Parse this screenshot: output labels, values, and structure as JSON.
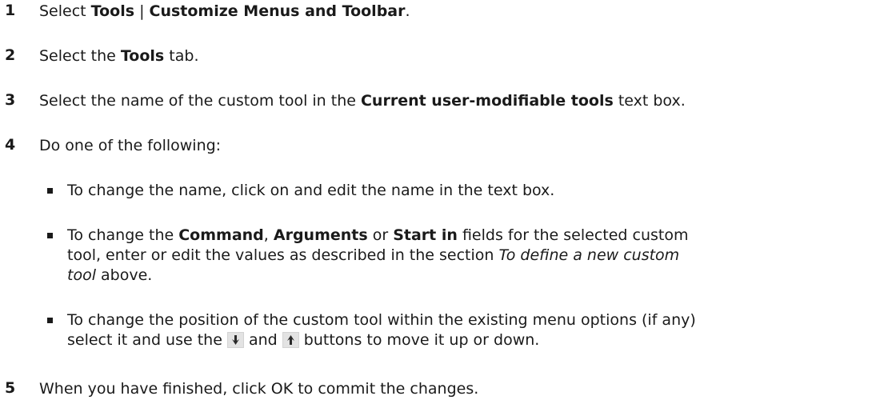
{
  "steps": [
    {
      "num": "1",
      "parts": [
        "Select ",
        "Tools",
        " | ",
        "Customize Menus and Toolbar",
        "."
      ]
    },
    {
      "num": "2",
      "parts": [
        "Select the ",
        "Tools",
        " tab."
      ]
    },
    {
      "num": "3",
      "parts": [
        "Select the name of the custom tool in the ",
        "Current user-modifiable tools",
        " text box."
      ]
    },
    {
      "num": "4",
      "text": "Do one of the following:"
    },
    {
      "num": "5",
      "text": "When you have finished, click OK to commit the changes."
    }
  ],
  "bullets": [
    {
      "text": "To change the name, click on and edit the name in the text box."
    },
    {
      "parts": [
        "To change the ",
        "Command",
        ", ",
        "Arguments",
        " or ",
        "Start in",
        " fields for the selected custom"
      ],
      "line2": [
        "tool, enter or edit the values as described in the section ",
        "To define a new custom"
      ],
      "line3": [
        "tool",
        " above."
      ]
    },
    {
      "line1": "To change the position of the custom tool within the existing menu options (if any)",
      "line2_before": "select it and use the ",
      "line2_mid": " and ",
      "line2_after": " buttons to move it up or down."
    }
  ],
  "icons": {
    "down_arrow": "down-arrow-icon",
    "up_arrow": "up-arrow-icon"
  },
  "colors": {
    "arrow_fill": "#2a2a2a",
    "button_bg": "#e3e3e3"
  }
}
